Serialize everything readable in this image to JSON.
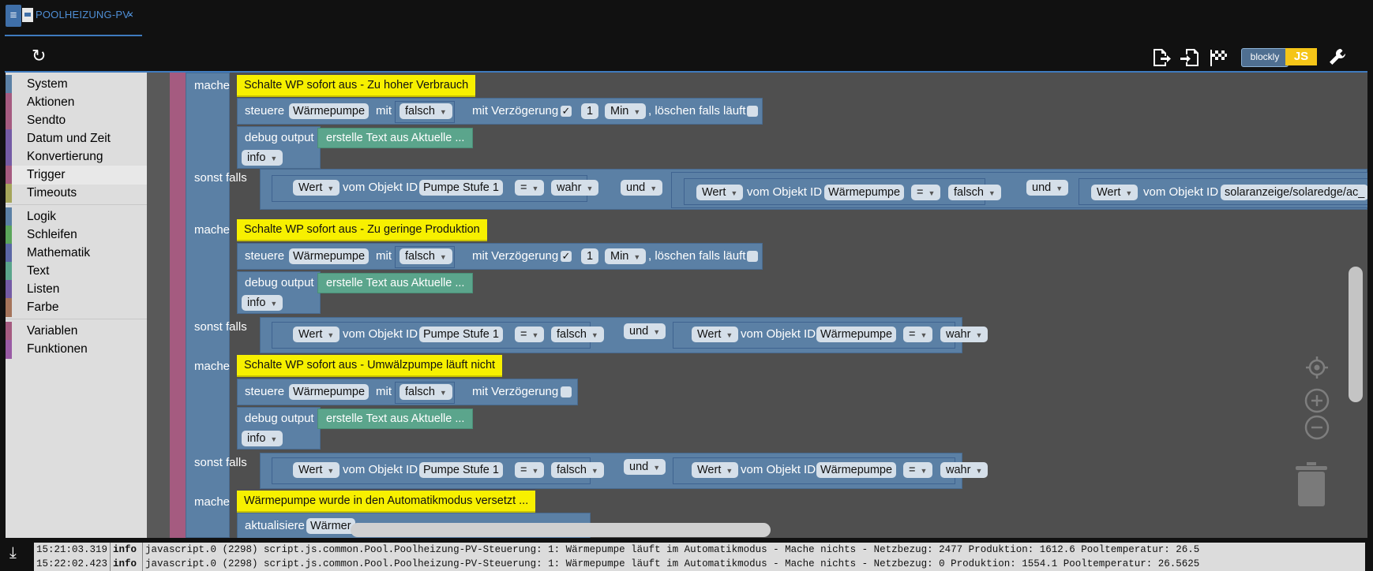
{
  "tab": {
    "title": "POOLHEIZUNG-PV-",
    "close": "×"
  },
  "toolbar": {
    "refresh_icon": "refresh-icon",
    "blockly_label": "blockly",
    "js_label": "JS"
  },
  "sidebar": {
    "groups": [
      [
        {
          "label": "System",
          "color": "#5b80a5"
        },
        {
          "label": "Aktionen",
          "color": "#a55b80"
        },
        {
          "label": "Sendto",
          "color": "#a55b80"
        },
        {
          "label": "Datum und Zeit",
          "color": "#745ba5"
        },
        {
          "label": "Konvertierung",
          "color": "#745ba5"
        },
        {
          "label": "Trigger",
          "color": "#a55b80"
        },
        {
          "label": "Timeouts",
          "color": "#a5a55b"
        }
      ],
      [
        {
          "label": "Logik",
          "color": "#5b80a5"
        },
        {
          "label": "Schleifen",
          "color": "#5ba55b"
        },
        {
          "label": "Mathematik",
          "color": "#5b67a5"
        },
        {
          "label": "Text",
          "color": "#5ba58c"
        },
        {
          "label": "Listen",
          "color": "#745ba5"
        },
        {
          "label": "Farbe",
          "color": "#a5745b"
        }
      ],
      [
        {
          "label": "Variablen",
          "color": "#a55b80"
        },
        {
          "label": "Funktionen",
          "color": "#995ba5"
        }
      ]
    ],
    "selected": "Trigger"
  },
  "blocks": {
    "mache": "mache",
    "sonst_falls": "sonst falls",
    "steuere": "steuere",
    "mit": "mit",
    "mit_verzoegerung": "mit Verzögerung",
    "loeschen": ", löschen falls läuft",
    "debug_output": "debug output",
    "info": "info",
    "erstelle_text": "erstelle Text aus Aktuelle ...",
    "wert": "Wert",
    "vom_objekt_id": "vom Objekt ID",
    "und": "und",
    "eq": "=",
    "waermepumpe": "Wärmepumpe",
    "pumpe_stufe1": "Pumpe Stufe 1",
    "wahr": "wahr",
    "falsch": "falsch",
    "one": "1",
    "min": "Min",
    "checkmark": "✓",
    "solar_id": "solaranzeige/solaredge/ac_",
    "aktualisiere": "aktualisiere",
    "waermer": "Wärmer",
    "comment1": "Schalte WP sofort aus - Zu hoher Verbrauch",
    "comment2": "Schalte WP sofort aus - Zu geringe Produktion",
    "comment3": "Schalte WP sofort aus - Umwälzpumpe läuft nicht",
    "comment4": "Wärmepumpe wurde in den Automatikmodus versetzt ..."
  },
  "log": [
    {
      "time": "15:21:03.319",
      "level": "info",
      "message": "javascript.0 (2298) script.js.common.Pool.Poolheizung-PV-Steuerung: 1: Wärmepumpe läuft im Automatikmodus - Mache nichts - Netzbezug: 2477 Produktion: 1612.6 Pooltemperatur: 26.5"
    },
    {
      "time": "15:22:02.423",
      "level": "info",
      "message": "javascript.0 (2298) script.js.common.Pool.Poolheizung-PV-Steuerung: 1: Wärmepumpe läuft im Automatikmodus - Mache nichts - Netzbezug: 0 Produktion: 1554.1 Pooltemperatur: 26.5625"
    }
  ]
}
